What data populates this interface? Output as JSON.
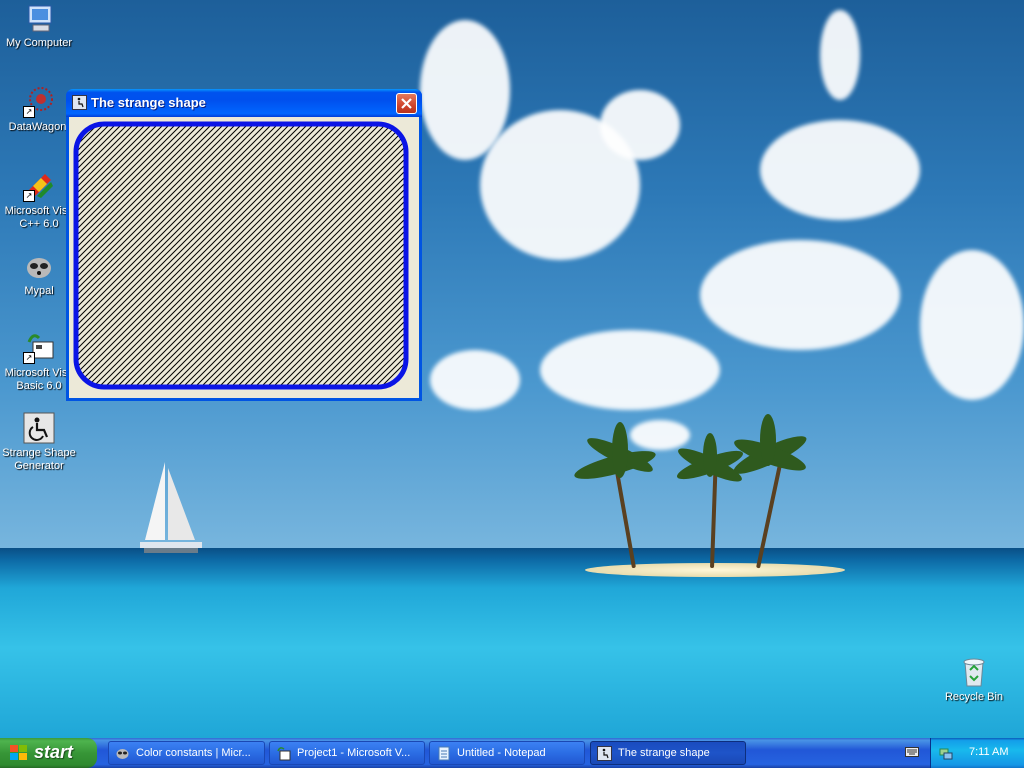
{
  "desktop": {
    "icons": [
      {
        "label": "My Computer"
      },
      {
        "label": "DataWagon."
      },
      {
        "label": "Microsoft Visu C++ 6.0"
      },
      {
        "label": "Mypal"
      },
      {
        "label": "Microsoft Visu Basic 6.0"
      },
      {
        "label": "Strange Shape Generator"
      },
      {
        "label": "Recycle Bin"
      }
    ]
  },
  "window": {
    "title": "The strange shape",
    "shape": {
      "border_color": "#0a14e6",
      "hatch_color": "#000000",
      "background": "#ece9d8"
    }
  },
  "taskbar": {
    "start_label": "start",
    "tasks": [
      {
        "label": "Color constants | Micr..."
      },
      {
        "label": "Project1 - Microsoft V..."
      },
      {
        "label": "Untitled - Notepad"
      },
      {
        "label": "The strange shape"
      }
    ],
    "clock": "7:11 AM"
  }
}
